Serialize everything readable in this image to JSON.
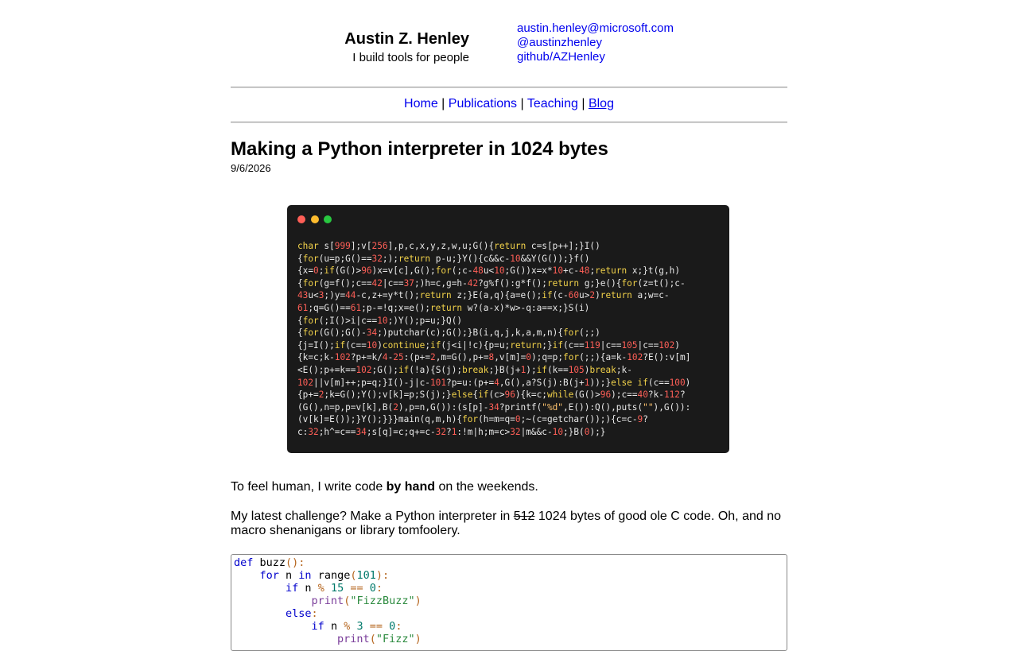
{
  "header": {
    "name": "Austin Z. Henley",
    "tagline": "I build tools for people",
    "links": [
      {
        "label": "austin.henley@microsoft.com"
      },
      {
        "label": "@austinzhenley"
      },
      {
        "label": "github/AZHenley"
      }
    ]
  },
  "nav": {
    "items": [
      {
        "label": "Home"
      },
      {
        "label": "Publications"
      },
      {
        "label": "Teaching"
      },
      {
        "label": "Blog"
      }
    ],
    "separator": "|"
  },
  "post": {
    "title": "Making a Python interpreter in 1024 bytes",
    "date": "9/6/2026",
    "p1_a": "To feel human, I write code ",
    "p1_bold": "by hand",
    "p1_b": " on the weekends.",
    "p2_a": "My latest challenge? Make a Python interpreter in ",
    "p2_struck": "512",
    "p2_b": " 1024 bytes of good ole C code. Oh, and no macro shenanigans or library tomfoolery."
  },
  "colors": {
    "link": "#0000ee",
    "window_bg": "#1a1a1a",
    "dot_red": "#ff5f57",
    "dot_yellow": "#febc2e",
    "dot_green": "#28c840"
  }
}
